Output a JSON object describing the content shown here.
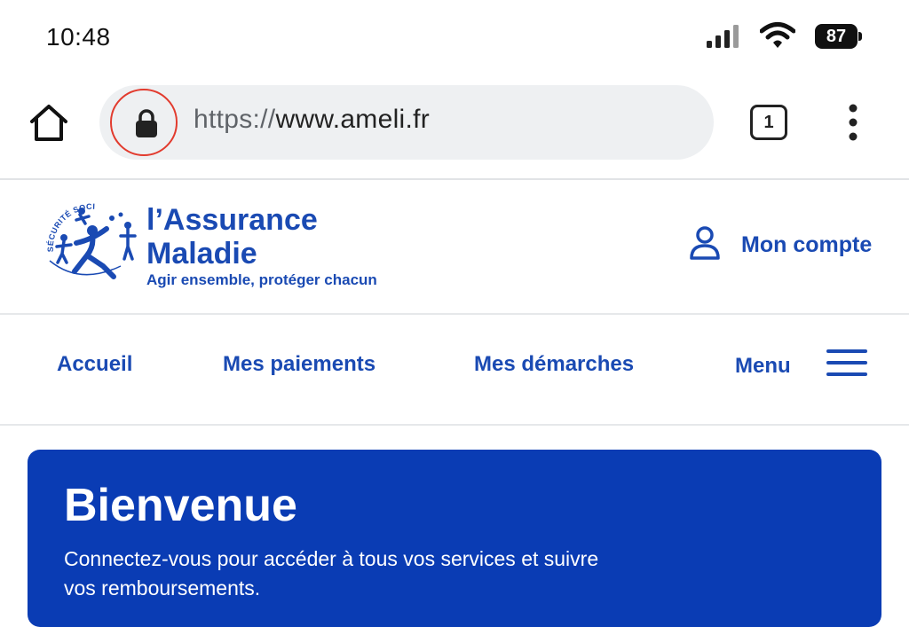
{
  "status_bar": {
    "time": "10:48",
    "battery": "87",
    "signal_icon": "signal-bars-icon",
    "wifi_icon": "wifi-icon"
  },
  "browser": {
    "url_scheme": "https://",
    "url_host": "www.ameli.fr",
    "tab_count": "1",
    "icons": [
      "home-icon",
      "lock-icon",
      "tabs-icon",
      "more-vert-icon"
    ],
    "highlight_color": "#e23b2e"
  },
  "site": {
    "logo_arc_text": "SÉCURITÉ SOCIALE",
    "brand_line1": "l’Assurance",
    "brand_line2": "Maladie",
    "tagline": "Agir ensemble, protéger chacun",
    "account_label": "Mon compte",
    "brand_color": "#1a4ab3"
  },
  "nav": {
    "items": [
      {
        "label": "Accueil"
      },
      {
        "label": "Mes paiements"
      },
      {
        "label": "Mes démarches"
      }
    ],
    "menu_label": "Menu"
  },
  "banner": {
    "title": "Bienvenue",
    "text": "Connectez-vous pour accéder à tous vos services et suivre vos remboursements.",
    "color": "#0a3cb4"
  }
}
